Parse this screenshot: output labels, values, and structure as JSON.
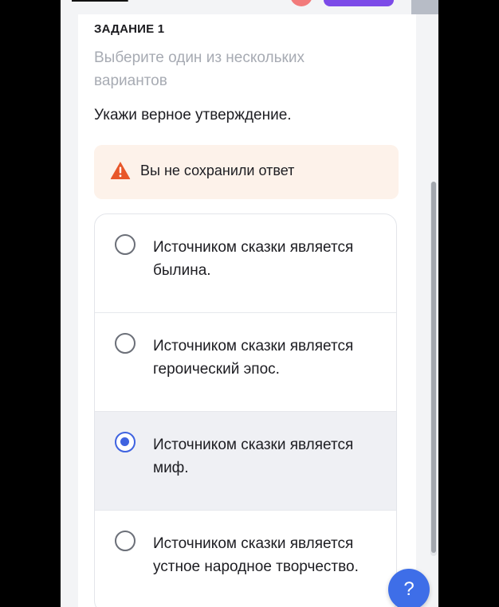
{
  "task": {
    "label": "ЗАДАНИЕ 1",
    "hint": "Выберите один из нескольких вариантов",
    "question": "Укажи верное утверждение."
  },
  "warning": {
    "text": "Вы не сохранили ответ",
    "icon": "warning-icon",
    "color": "#e8572a"
  },
  "options": [
    {
      "text": "Источником сказки является былина.",
      "selected": false
    },
    {
      "text": "Источником сказки является героический эпос.",
      "selected": false
    },
    {
      "text": "Источником сказки является миф.",
      "selected": true
    },
    {
      "text": "Источником сказки является устное народное творчество.",
      "selected": false
    }
  ],
  "help": {
    "label": "?"
  },
  "colors": {
    "accent": "#3f63e0",
    "brand_button": "#7c4be8",
    "warning_bg": "#fdf2ea"
  }
}
